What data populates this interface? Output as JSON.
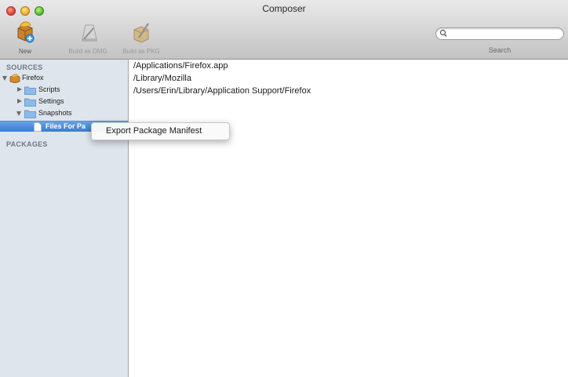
{
  "window": {
    "title": "Composer"
  },
  "toolbar": {
    "new_label": "New",
    "build_dmg_label": "Build as DMG",
    "build_pkg_label": "Build as PKG",
    "search": {
      "value": "",
      "label": "Search"
    }
  },
  "sidebar": {
    "sources_heading": "SOURCES",
    "packages_heading": "PACKAGES",
    "items": [
      {
        "label": "Firefox",
        "icon": "firefox-package-icon",
        "expanded": true
      },
      {
        "label": "Scripts",
        "icon": "folder-icon",
        "expanded": false
      },
      {
        "label": "Settings",
        "icon": "folder-icon",
        "expanded": false
      },
      {
        "label": "Snapshots",
        "icon": "folder-icon",
        "expanded": true
      },
      {
        "label": "Files For Pa",
        "icon": "document-icon",
        "selected": true
      }
    ]
  },
  "content": {
    "paths": [
      "/Applications/Firefox.app",
      "/Library/Mozilla",
      "/Users/Erin/Library/Application Support/Firefox"
    ]
  },
  "context_menu": {
    "items": [
      {
        "label": "Export Package Manifest"
      }
    ]
  },
  "colors": {
    "selection": "#3a7bd5",
    "sidebar_bg": "#dfe5ec",
    "folder": "#7fb2e0"
  }
}
